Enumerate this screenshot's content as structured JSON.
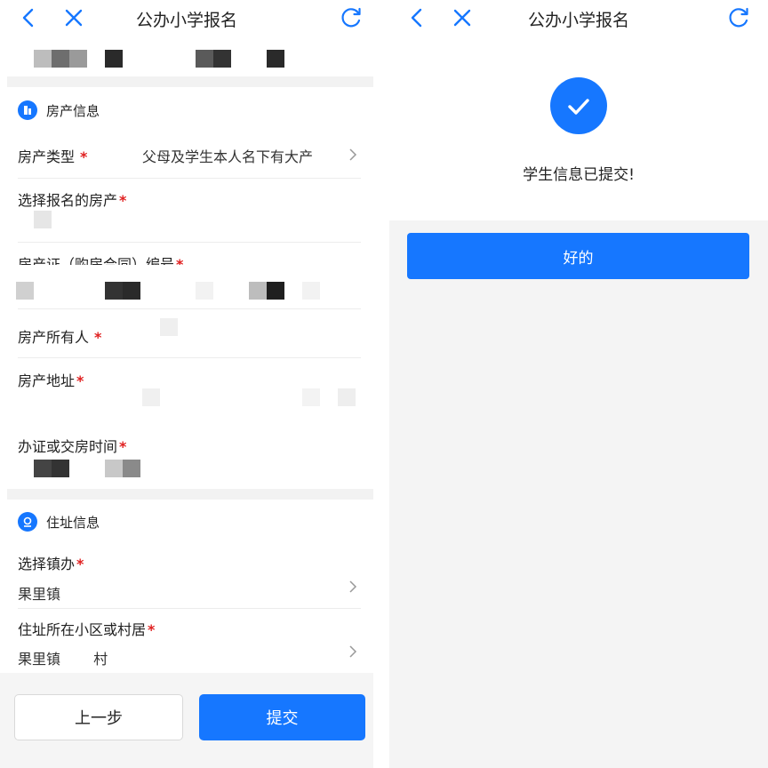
{
  "left": {
    "header": {
      "title": "公办小学报名"
    },
    "sections": {
      "property": {
        "title": "房产信息"
      },
      "residence": {
        "title": "住址信息"
      }
    },
    "fields": {
      "property_type": {
        "label": "房产类型",
        "required": "*",
        "value": "父母及学生本人名下有大产"
      },
      "select_property": {
        "label": "选择报名的房产",
        "required": "*"
      },
      "cert_number": {
        "label": "房产证（购房合同）编号",
        "required": "*"
      },
      "owner": {
        "label": "房产所有人",
        "required": "*"
      },
      "address": {
        "label": "房产地址",
        "required": "*"
      },
      "cert_time": {
        "label": "办证或交房时间",
        "required": "*"
      },
      "town": {
        "label": "选择镇办",
        "required": "*",
        "value": "果里镇"
      },
      "community": {
        "label": "住址所在小区或村居",
        "required": "*",
        "value": "果里镇　　 村"
      }
    },
    "buttons": {
      "prev": "上一步",
      "submit": "提交"
    }
  },
  "right": {
    "header": {
      "title": "公办小学报名"
    },
    "success_message": "学生信息已提交!",
    "ok_button": "好的"
  },
  "colors": {
    "accent": "#1677ff",
    "required": "#e02020",
    "band": "#f2f2f2"
  },
  "icons": [
    "back-icon",
    "close-icon",
    "refresh-icon",
    "house-icon",
    "location-icon",
    "chevron-right-icon",
    "check-icon"
  ]
}
